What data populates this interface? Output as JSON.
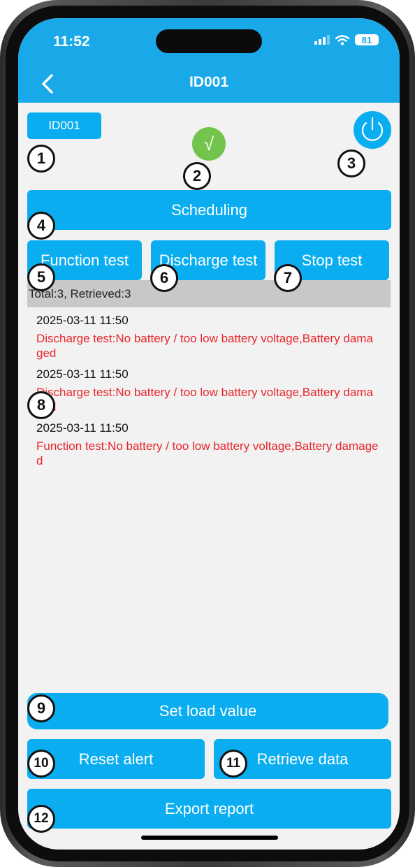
{
  "status_bar": {
    "time": "11:52",
    "battery": "81"
  },
  "header": {
    "title": "ID001"
  },
  "device": {
    "id_label": "ID001",
    "status_symbol": "√"
  },
  "buttons": {
    "scheduling": "Scheduling",
    "function_test": "Function test",
    "discharge_test": "Discharge test",
    "stop_test": "Stop test",
    "set_load_value": "Set load value",
    "reset_alert": "Reset alert",
    "retrieve_data": "Retrieve data",
    "export_report": "Export report"
  },
  "summary": "Total:3, Retrieved:3",
  "logs": [
    {
      "time": "2025-03-11 11:50",
      "message": "Discharge test:No battery / too low battery voltage,Battery damaged"
    },
    {
      "time": "2025-03-11 11:50",
      "message": "Discharge test:No battery / too low battery voltage,Battery damaged"
    },
    {
      "time": "2025-03-11 11:50",
      "message": "Function test:No battery / too low battery voltage,Battery damaged"
    }
  ],
  "markers": [
    "1",
    "2",
    "3",
    "4",
    "5",
    "6",
    "7",
    "8",
    "9",
    "10",
    "11",
    "12"
  ],
  "colors": {
    "header": "#1aa9e8",
    "button": "#0aaef0",
    "error_text": "#e8252a",
    "ok_status": "#72c44a"
  },
  "icons": {
    "back": "chevron-left-icon",
    "power": "power-icon",
    "status": "check-icon"
  }
}
